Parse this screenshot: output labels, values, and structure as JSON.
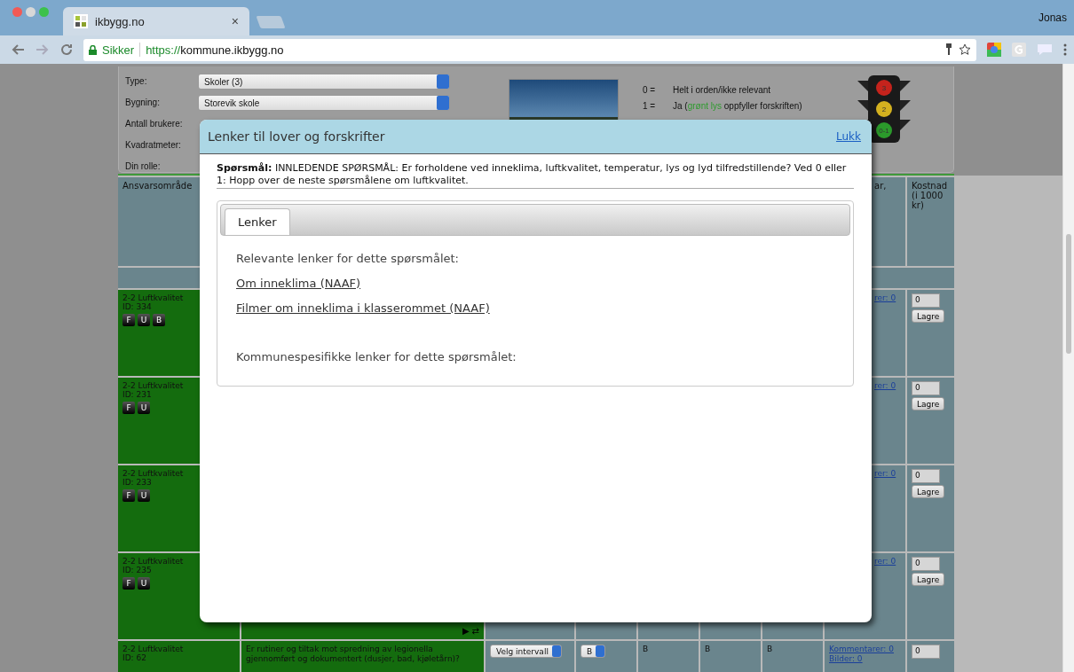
{
  "browser": {
    "tab_title": "ikbygg.no",
    "tab_close": "×",
    "profile": "Jonas",
    "security_label": "Sikker",
    "url_scheme": "https://",
    "url_host": "kommune.ikbygg.no"
  },
  "info_panel": {
    "fields": [
      {
        "label": "Type:",
        "kind": "select",
        "value": "Skoler (3)"
      },
      {
        "label": "Bygning:",
        "kind": "select",
        "value": "Storevik skole"
      },
      {
        "label": "Antall brukere:",
        "kind": "text"
      },
      {
        "label": "Kvadratmeter:",
        "kind": "text"
      },
      {
        "label": "Din rolle:",
        "kind": "text"
      }
    ],
    "legend": [
      {
        "code": "0 =",
        "before": "Helt i orden/ikke relevant"
      },
      {
        "code": "1 =",
        "before": "Ja (",
        "highlight": "grønt lys",
        "after": " oppfyller forskriften)"
      }
    ],
    "traffic_light": [
      "3",
      "2",
      "0-1"
    ]
  },
  "table": {
    "header": {
      "area": "Ansvarsområde",
      "comments": "ar,",
      "cost": "Kostnad (i 1000 kr)"
    },
    "rows": [
      {
        "area": "2-2 Luftkvalitet",
        "id": "ID: 334",
        "badges": [
          "F",
          "U",
          "B"
        ],
        "comments": [
          "rer: 0"
        ],
        "cost": "0",
        "save": "Lagre"
      },
      {
        "area": "2-2 Luftkvalitet",
        "id": "ID: 231",
        "badges": [
          "F",
          "U"
        ],
        "comments": [
          "rer: 0"
        ],
        "cost": "0",
        "save": "Lagre"
      },
      {
        "area": "2-2 Luftkvalitet",
        "id": "ID: 233",
        "badges": [
          "F",
          "U"
        ],
        "comments": [
          "rer: 0"
        ],
        "cost": "0",
        "save": "Lagre"
      },
      {
        "area": "2-2 Luftkvalitet",
        "id": "ID: 235",
        "badges": [
          "F",
          "U"
        ],
        "comments": [
          "rer: 0"
        ],
        "cost": "0",
        "save": "Lagre",
        "question_tools": [
          "▶",
          "⇄"
        ]
      },
      {
        "area": "2-2 Luftkvalitet",
        "id": "ID: 62",
        "question": "Er rutiner og tiltak mot spredning av legionella gjennomført og dokumentert (dusjer, bad, kjøletårn)?",
        "interval": "Velg intervall",
        "grade": "B",
        "marks": [
          "B",
          "B",
          "B"
        ],
        "comments": [
          "Kommentarer: 0",
          "Bilder: 0"
        ],
        "cost": "0"
      }
    ]
  },
  "modal": {
    "title": "Lenker til lover og forskrifter",
    "close": "Lukk",
    "question": "**Spørsmål:** INNLEDENDE SPØRSMÅL: Er forholdene ved inneklima, luftkvalitet, temperatur, lys og lyd tilfredstillende? Ved 0 eller 1: Hopp over de neste spørsmålene om luftkvalitet.",
    "tabs": [
      {
        "label": "Lenker",
        "selected": true
      }
    ],
    "sections": [
      {
        "heading": "Relevante lenker for dette spørsmålet:",
        "links": [
          "Om inneklima (NAAF)",
          "Filmer om inneklima i klasserommet (NAAF)"
        ]
      },
      {
        "heading": "Kommunespesifikke lenker for dette spørsmålet:"
      }
    ]
  }
}
